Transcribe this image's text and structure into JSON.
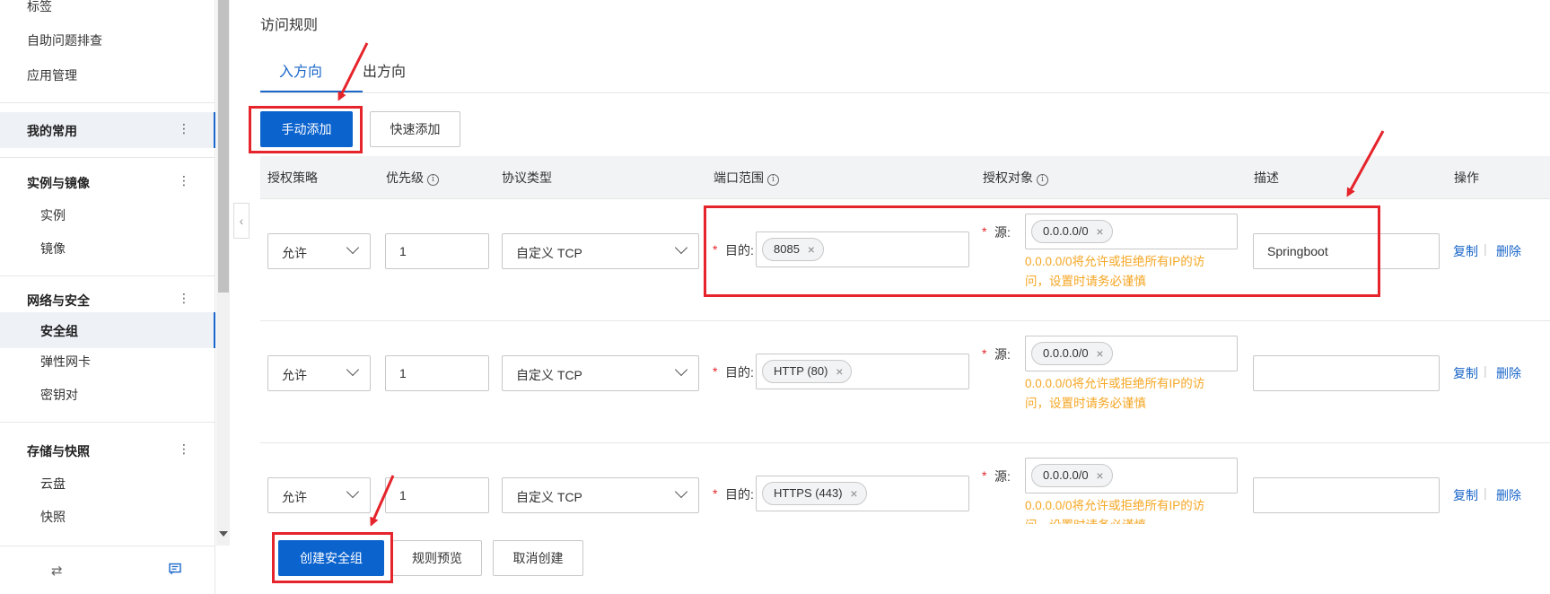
{
  "sidebar": {
    "top_items": [
      "标签",
      "自助问题排查",
      "应用管理"
    ],
    "favorites": "我的常用",
    "groups": {
      "instances": {
        "label": "实例与镜像",
        "items": [
          "实例",
          "镜像"
        ]
      },
      "network": {
        "label": "网络与安全",
        "items": [
          "安全组",
          "弹性网卡",
          "密钥对"
        ]
      },
      "storage": {
        "label": "存储与快照",
        "items": [
          "云盘",
          "快照"
        ]
      }
    },
    "more_icon": "more-vertical-icon",
    "footer_icons": [
      "swap-icon",
      "message-icon"
    ]
  },
  "main": {
    "title": "访问规则",
    "tabs": [
      "入方向",
      "出方向"
    ],
    "buttons": {
      "manual_add": "手动添加",
      "quick_add": "快速添加"
    },
    "columns": [
      "授权策略",
      "优先级",
      "协议类型",
      "端口范围",
      "授权对象",
      "描述",
      "操作"
    ],
    "labels": {
      "dest": "目的:",
      "source": "源:",
      "required": "*"
    },
    "warning": [
      "0.0.0.0/0将允许或拒绝所有IP的访",
      "问，设置时请务必谨慎"
    ],
    "actions": {
      "copy": "复制",
      "delete": "删除"
    },
    "rules": [
      {
        "policy": "允许",
        "priority": "1",
        "protocol": "自定义 TCP",
        "port": "8085",
        "source": "0.0.0.0/0",
        "description": "Springboot"
      },
      {
        "policy": "允许",
        "priority": "1",
        "protocol": "自定义 TCP",
        "port": "HTTP (80)",
        "source": "0.0.0.0/0",
        "description": ""
      },
      {
        "policy": "允许",
        "priority": "1",
        "protocol": "自定义 TCP",
        "port": "HTTPS (443)",
        "source": "0.0.0.0/0",
        "description": ""
      }
    ],
    "footer_buttons": {
      "create": "创建安全组",
      "preview": "规则预览",
      "cancel": "取消创建"
    }
  },
  "colors": {
    "primary": "#0b63ce",
    "annotation_red": "#e5242b",
    "warning": "#f5a623",
    "link": "#1a66c9"
  }
}
